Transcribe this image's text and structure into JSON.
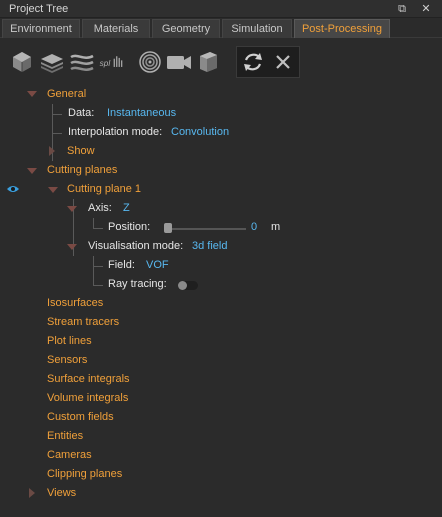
{
  "window": {
    "title": "Project Tree"
  },
  "tabs": [
    {
      "label": "Environment"
    },
    {
      "label": "Materials"
    },
    {
      "label": "Geometry"
    },
    {
      "label": "Simulation"
    },
    {
      "label": "Post-Processing"
    }
  ],
  "toolbar": {
    "icons": [
      "cube-icon",
      "layers-icon",
      "stream-icon",
      "splat-icon",
      "target-icon",
      "camera-icon",
      "box-clip-icon",
      "refresh-icon",
      "close-icon"
    ],
    "splat_text": "spl"
  },
  "tree": {
    "general": {
      "label": "General",
      "data_label": "Data:",
      "data_value": "Instantaneous",
      "interp_label": "Interpolation mode:",
      "interp_value": "Convolution",
      "show_label": "Show"
    },
    "cutting_planes": {
      "label": "Cutting planes",
      "plane1": {
        "label": "Cutting plane 1",
        "axis_label": "Axis:",
        "axis_value": "Z",
        "position_label": "Position:",
        "position_value": "0",
        "position_unit": "m",
        "vis_label": "Visualisation mode:",
        "vis_value": "3d field",
        "field_label": "Field:",
        "field_value": "VOF",
        "ray_label": "Ray tracing:",
        "ray_tracing_on": false
      }
    },
    "items": [
      {
        "label": "Isosurfaces"
      },
      {
        "label": "Stream tracers"
      },
      {
        "label": "Plot lines"
      },
      {
        "label": "Sensors"
      },
      {
        "label": "Surface integrals"
      },
      {
        "label": "Volume integrals"
      },
      {
        "label": "Custom fields"
      },
      {
        "label": "Entities"
      },
      {
        "label": "Cameras"
      },
      {
        "label": "Clipping planes"
      },
      {
        "label": "Views"
      }
    ]
  },
  "colors": {
    "accent": "#f0a03a",
    "value": "#58b8f0",
    "background": "#2b2b2b"
  }
}
